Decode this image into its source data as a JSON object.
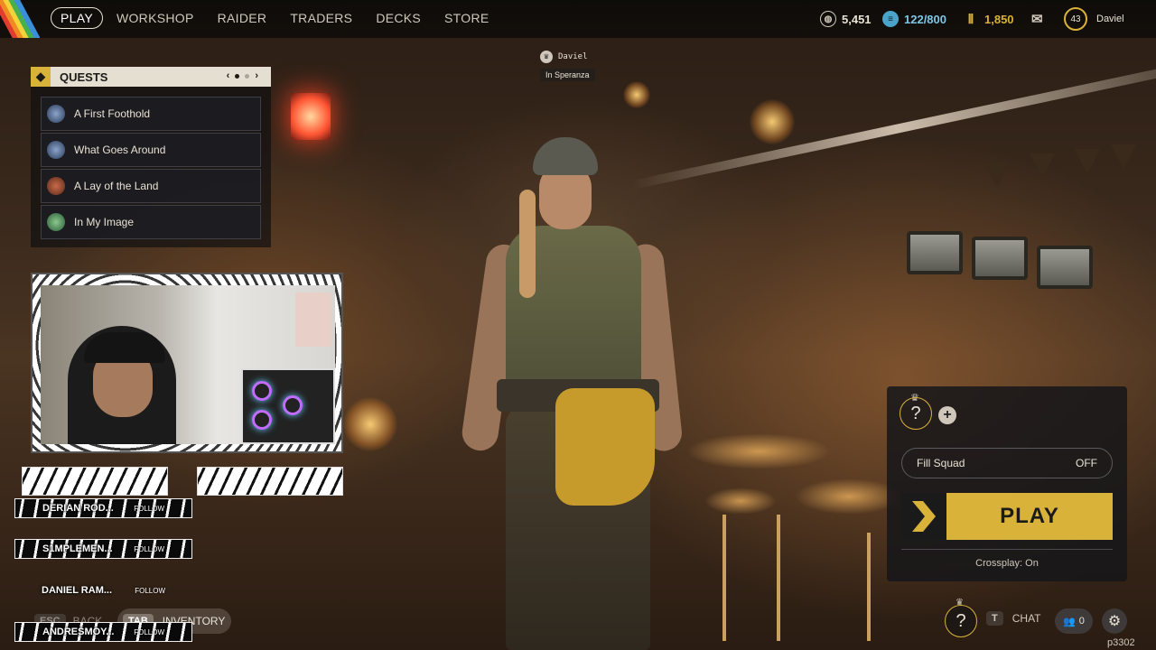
{
  "nav": {
    "items": [
      "PLAY",
      "WORKSHOP",
      "RAIDER",
      "TRADERS",
      "DECKS",
      "STORE"
    ],
    "active": "PLAY"
  },
  "currencies": {
    "raider_tokens": "5,451",
    "storage": "122/800",
    "coins": "1,850"
  },
  "profile": {
    "level": "43",
    "username": "Daviel"
  },
  "quests": {
    "title": "QUESTS",
    "items": [
      "A First Foothold",
      "What Goes Around",
      "A Lay of the Land",
      "In My Image"
    ]
  },
  "player_tag": {
    "name": "Daviel",
    "location": "In Speranza"
  },
  "followers": {
    "follow_label": "FOLLOW",
    "names": [
      "DERIAN ROD...",
      "S1MPLEMEN...",
      "DANIEL RAM...",
      "ANDRESMOY..."
    ]
  },
  "key_hints": {
    "back_key": "ESC",
    "back_label": "BACK",
    "inventory_key": "TAB",
    "inventory_label": "INVENTORY"
  },
  "squad": {
    "fill_squad_label": "Fill Squad",
    "fill_squad_value": "OFF",
    "play_label": "PLAY",
    "crossplay": "Crossplay: On"
  },
  "bottom_right": {
    "chat_key": "T",
    "chat_label": "CHAT",
    "friends_count": "0",
    "build": "p3302"
  },
  "colors": {
    "accent": "#d9b23a",
    "panel": "#16161a",
    "text": "#e8e2d4"
  }
}
